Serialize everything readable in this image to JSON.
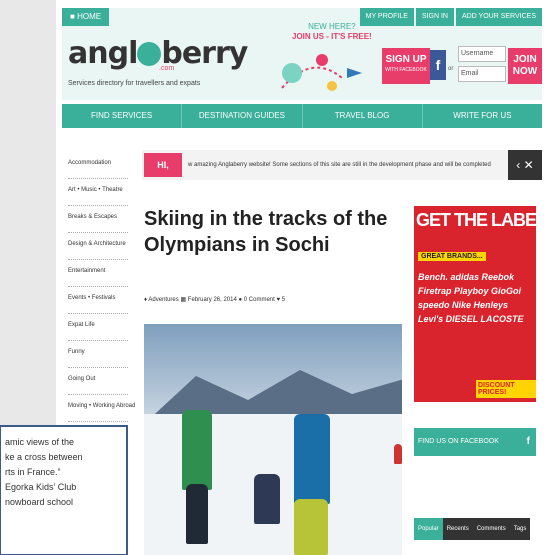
{
  "header": {
    "home": "HOME",
    "top_links": [
      "MY PROFILE",
      "SIGN IN",
      "ADD YOUR SERVICES"
    ],
    "logo": "anglOberry",
    "logo_com": ".com",
    "tagline": "Services directory for travellers and expats",
    "new_here_line1": "NEW HERE?",
    "new_here_line2": "JOIN US - IT'S FREE!",
    "signup": "SIGN UP",
    "signup_sub": "WITH FACEBOOK",
    "fb": "f",
    "or": "or",
    "username_placeholder": "Username",
    "email_placeholder": "Email",
    "join": "JOIN NOW"
  },
  "nav": [
    "FIND SERVICES",
    "DESTINATION GUIDES",
    "TRAVEL BLOG",
    "WRITE FOR US"
  ],
  "sidebar": [
    "Accommodation",
    "Art • Music • Theatre",
    "Breaks & Escapes",
    "Design & Architecture",
    "Entertainment",
    "Events • Festivals",
    "Expat Life",
    "Funny",
    "Going Out",
    "Moving • Working Abroad"
  ],
  "notice": {
    "tag": "HI, THERE!",
    "text": "w amazing Anglaberry website!     Some sections of this site are still in the development phase and will be completed",
    "controls": "‹ ✕"
  },
  "article": {
    "title": "Skiing in the tracks of the Olympians in Sochi",
    "category": "Adventures",
    "date": "February 26, 2014",
    "comments": "0 Comment",
    "likes": "5"
  },
  "ad": {
    "title": "GET THE LABEL",
    "sub": "GREAT BRANDS...",
    "brands": "Bench. adidas Reebok Firetrap Playboy GioGoi speedo Nike Henleys Levi's DIESEL LACOSTE",
    "discount": "DISCOUNT PRICES!"
  },
  "facebook_widget": {
    "label": "FIND US ON FACEBOOK",
    "icon": "f"
  },
  "tabs": [
    "Popular",
    "Recents",
    "Comments",
    "Tags"
  ],
  "overlay": {
    "lines": [
      "amic views of the",
      "ke a cross between",
      "rts in France.”",
      "",
      "Egorka Kids’ Club",
      "nowboard school"
    ]
  },
  "colors": {
    "accent": "#3aaf9a",
    "pink": "#e83c6b",
    "ad_red": "#d9232d",
    "facebook": "#3b5998"
  }
}
